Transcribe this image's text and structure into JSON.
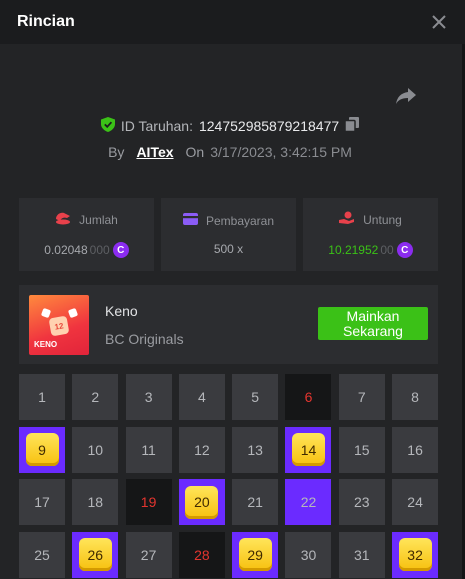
{
  "header": {
    "title": "Rincian"
  },
  "bet": {
    "id_label": "ID Taruhan:",
    "id_value": "124752985879218477",
    "by_label": "By",
    "user": "AITex",
    "on_label": "On",
    "date": "3/17/2023, 3:42:15 PM"
  },
  "stats": [
    {
      "label": "Jumlah",
      "value_main": "0.02048",
      "value_dim": "000",
      "coin": "C"
    },
    {
      "label": "Pembayaran",
      "value_main": "500 x",
      "value_dim": ""
    },
    {
      "label": "Untung",
      "value_main": "10.21952",
      "value_dim": "00",
      "coin": "C",
      "color": "#3bc117"
    }
  ],
  "game": {
    "name": "Keno",
    "provider": "BC Originals",
    "thumb_text": "KENO",
    "thumb_ball": "12",
    "play_label": "Mainkan Sekarang"
  },
  "board": {
    "cells": [
      {
        "n": "1",
        "s": "normal"
      },
      {
        "n": "2",
        "s": "normal"
      },
      {
        "n": "3",
        "s": "normal"
      },
      {
        "n": "4",
        "s": "normal"
      },
      {
        "n": "5",
        "s": "normal"
      },
      {
        "n": "6",
        "s": "miss"
      },
      {
        "n": "7",
        "s": "normal"
      },
      {
        "n": "8",
        "s": "normal"
      },
      {
        "n": "9",
        "s": "hit"
      },
      {
        "n": "10",
        "s": "normal"
      },
      {
        "n": "11",
        "s": "normal"
      },
      {
        "n": "12",
        "s": "normal"
      },
      {
        "n": "13",
        "s": "normal"
      },
      {
        "n": "14",
        "s": "hit"
      },
      {
        "n": "15",
        "s": "normal"
      },
      {
        "n": "16",
        "s": "normal"
      },
      {
        "n": "17",
        "s": "normal"
      },
      {
        "n": "18",
        "s": "normal"
      },
      {
        "n": "19",
        "s": "miss"
      },
      {
        "n": "20",
        "s": "hit"
      },
      {
        "n": "21",
        "s": "normal"
      },
      {
        "n": "22",
        "s": "pick"
      },
      {
        "n": "23",
        "s": "normal"
      },
      {
        "n": "24",
        "s": "normal"
      },
      {
        "n": "25",
        "s": "normal"
      },
      {
        "n": "26",
        "s": "hit"
      },
      {
        "n": "27",
        "s": "normal"
      },
      {
        "n": "28",
        "s": "miss"
      },
      {
        "n": "29",
        "s": "hit"
      },
      {
        "n": "30",
        "s": "normal"
      },
      {
        "n": "31",
        "s": "normal"
      },
      {
        "n": "32",
        "s": "hit"
      }
    ]
  },
  "colors": {
    "accent_green": "#3bc117",
    "accent_purple": "#6b2bff",
    "miss_red": "#e4352f"
  }
}
